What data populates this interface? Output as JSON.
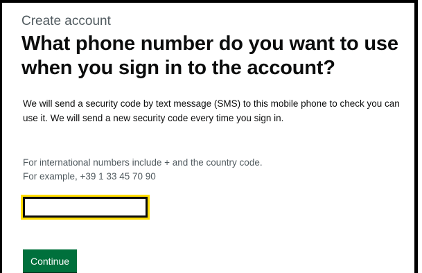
{
  "page": {
    "caption": "Create account",
    "heading": "What phone number do you want to use when you sign in to the account?",
    "body": "We will send a security code by text message (SMS) to this mobile phone to check you can use it. We will send a new security code every time you sign in.",
    "hint_line1": "For international numbers include + and the country code.",
    "hint_line2": "For example, +39 1 33 45 70 90"
  },
  "form": {
    "phone_value": "",
    "continue_label": "Continue"
  },
  "colors": {
    "button_green": "#00703c",
    "focus_yellow": "#ffdd00",
    "text": "#0b0c0c",
    "secondary_text": "#505a5f"
  }
}
